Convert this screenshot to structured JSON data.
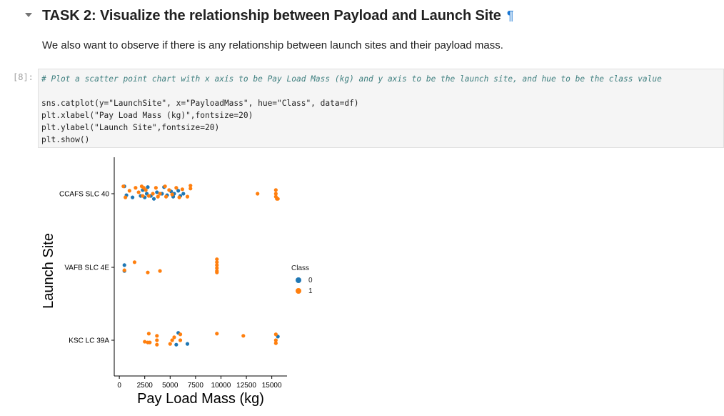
{
  "markdown": {
    "heading": "TASK 2: Visualize the relationship between Payload and Launch Site",
    "anchor": "¶",
    "intro": "We also want to observe if there is any relationship between launch sites and their payload mass."
  },
  "code_cell": {
    "prompt": "[8]:",
    "lines": [
      "# Plot a scatter point chart with x axis to be Pay Load Mass (kg) and y axis to be the launch site, and hue to be the class value",
      "",
      "sns.catplot(y=\"LaunchSite\", x=\"PayloadMass\", hue=\"Class\", data=df)",
      "plt.xlabel(\"Pay Load Mass (kg)\",fontsize=20)",
      "plt.ylabel(\"Launch Site\",fontsize=20)",
      "plt.show()"
    ]
  },
  "chart_data": {
    "type": "scatter",
    "xlabel": "Pay Load Mass (kg)",
    "ylabel": "Launch Site",
    "categories": [
      "CCAFS SLC 40",
      "VAFB SLC 4E",
      "KSC LC 39A"
    ],
    "x_ticks": [
      "0",
      "2500",
      "5000",
      "7500",
      "10000",
      "12500",
      "15000"
    ],
    "xlim": [
      -500,
      16500
    ],
    "legend": {
      "title": "Class",
      "placement": "right",
      "entries": [
        "0",
        "1"
      ]
    },
    "colors": {
      "0": "#1f77b4",
      "1": "#ff7f0e"
    },
    "series": [
      {
        "name": "0",
        "points": [
          {
            "site": "CCAFS SLC 40",
            "x": 500,
            "j": -0.1
          },
          {
            "site": "CCAFS SLC 40",
            "x": 700,
            "j": 0.02
          },
          {
            "site": "CCAFS SLC 40",
            "x": 1300,
            "j": 0.05
          },
          {
            "site": "CCAFS SLC 40",
            "x": 2100,
            "j": 0.03
          },
          {
            "site": "CCAFS SLC 40",
            "x": 2300,
            "j": -0.05
          },
          {
            "site": "CCAFS SLC 40",
            "x": 2500,
            "j": 0.05
          },
          {
            "site": "CCAFS SLC 40",
            "x": 2700,
            "j": 0.0
          },
          {
            "site": "CCAFS SLC 40",
            "x": 2800,
            "j": -0.09
          },
          {
            "site": "CCAFS SLC 40",
            "x": 3100,
            "j": 0.03
          },
          {
            "site": "CCAFS SLC 40",
            "x": 3400,
            "j": 0.07
          },
          {
            "site": "CCAFS SLC 40",
            "x": 3700,
            "j": -0.02
          },
          {
            "site": "CCAFS SLC 40",
            "x": 4200,
            "j": 0.0
          },
          {
            "site": "CCAFS SLC 40",
            "x": 4400,
            "j": -0.09
          },
          {
            "site": "CCAFS SLC 40",
            "x": 4700,
            "j": 0.02
          },
          {
            "site": "CCAFS SLC 40",
            "x": 5100,
            "j": -0.03
          },
          {
            "site": "CCAFS SLC 40",
            "x": 5300,
            "j": 0.04
          },
          {
            "site": "CCAFS SLC 40",
            "x": 5400,
            "j": 0.0
          },
          {
            "site": "CCAFS SLC 40",
            "x": 5800,
            "j": -0.04
          },
          {
            "site": "CCAFS SLC 40",
            "x": 6000,
            "j": 0.03
          },
          {
            "site": "CCAFS SLC 40",
            "x": 6300,
            "j": 0.0
          },
          {
            "site": "VAFB SLC 4E",
            "x": 500,
            "j": -0.03
          },
          {
            "site": "VAFB SLC 4E",
            "x": 500,
            "j": 0.05
          },
          {
            "site": "KSC LC 39A",
            "x": 5800,
            "j": -0.1
          },
          {
            "site": "KSC LC 39A",
            "x": 5600,
            "j": 0.06
          },
          {
            "site": "KSC LC 39A",
            "x": 6700,
            "j": 0.05
          },
          {
            "site": "KSC LC 39A",
            "x": 15600,
            "j": -0.05
          }
        ]
      },
      {
        "name": "1",
        "points": [
          {
            "site": "CCAFS SLC 40",
            "x": 400,
            "j": -0.1
          },
          {
            "site": "CCAFS SLC 40",
            "x": 600,
            "j": 0.05
          },
          {
            "site": "CCAFS SLC 40",
            "x": 1000,
            "j": -0.04
          },
          {
            "site": "CCAFS SLC 40",
            "x": 1600,
            "j": -0.08
          },
          {
            "site": "CCAFS SLC 40",
            "x": 1900,
            "j": -0.02
          },
          {
            "site": "CCAFS SLC 40",
            "x": 2200,
            "j": -0.1
          },
          {
            "site": "CCAFS SLC 40",
            "x": 2300,
            "j": 0.03
          },
          {
            "site": "CCAFS SLC 40",
            "x": 2400,
            "j": -0.08
          },
          {
            "site": "CCAFS SLC 40",
            "x": 2600,
            "j": -0.05
          },
          {
            "site": "CCAFS SLC 40",
            "x": 2900,
            "j": 0.03
          },
          {
            "site": "CCAFS SLC 40",
            "x": 3300,
            "j": 0.0
          },
          {
            "site": "CCAFS SLC 40",
            "x": 3600,
            "j": -0.08
          },
          {
            "site": "CCAFS SLC 40",
            "x": 3800,
            "j": 0.04
          },
          {
            "site": "CCAFS SLC 40",
            "x": 4000,
            "j": 0.0
          },
          {
            "site": "CCAFS SLC 40",
            "x": 4500,
            "j": -0.1
          },
          {
            "site": "CCAFS SLC 40",
            "x": 4600,
            "j": 0.04
          },
          {
            "site": "CCAFS SLC 40",
            "x": 4900,
            "j": -0.05
          },
          {
            "site": "CCAFS SLC 40",
            "x": 5200,
            "j": 0.01
          },
          {
            "site": "CCAFS SLC 40",
            "x": 5600,
            "j": -0.08
          },
          {
            "site": "CCAFS SLC 40",
            "x": 5900,
            "j": 0.05
          },
          {
            "site": "CCAFS SLC 40",
            "x": 6200,
            "j": -0.06
          },
          {
            "site": "CCAFS SLC 40",
            "x": 6700,
            "j": 0.04
          },
          {
            "site": "CCAFS SLC 40",
            "x": 7000,
            "j": -0.07
          },
          {
            "site": "CCAFS SLC 40",
            "x": 7000,
            "j": -0.11
          },
          {
            "site": "CCAFS SLC 40",
            "x": 13600,
            "j": 0.0
          },
          {
            "site": "CCAFS SLC 40",
            "x": 15400,
            "j": -0.05
          },
          {
            "site": "CCAFS SLC 40",
            "x": 15400,
            "j": 0.0
          },
          {
            "site": "CCAFS SLC 40",
            "x": 15400,
            "j": 0.04
          },
          {
            "site": "CCAFS SLC 40",
            "x": 15500,
            "j": 0.07
          },
          {
            "site": "CCAFS SLC 40",
            "x": 15600,
            "j": 0.07
          },
          {
            "site": "VAFB SLC 4E",
            "x": 500,
            "j": 0.04
          },
          {
            "site": "VAFB SLC 4E",
            "x": 1500,
            "j": -0.07
          },
          {
            "site": "VAFB SLC 4E",
            "x": 2800,
            "j": 0.07
          },
          {
            "site": "VAFB SLC 4E",
            "x": 4000,
            "j": 0.05
          },
          {
            "site": "VAFB SLC 4E",
            "x": 9600,
            "j": -0.11
          },
          {
            "site": "VAFB SLC 4E",
            "x": 9600,
            "j": -0.07
          },
          {
            "site": "VAFB SLC 4E",
            "x": 9600,
            "j": -0.03
          },
          {
            "site": "VAFB SLC 4E",
            "x": 9600,
            "j": 0.01
          },
          {
            "site": "VAFB SLC 4E",
            "x": 9600,
            "j": 0.05
          },
          {
            "site": "VAFB SLC 4E",
            "x": 9600,
            "j": 0.07
          },
          {
            "site": "KSC LC 39A",
            "x": 2500,
            "j": 0.02
          },
          {
            "site": "KSC LC 39A",
            "x": 2800,
            "j": 0.03
          },
          {
            "site": "KSC LC 39A",
            "x": 3000,
            "j": 0.03
          },
          {
            "site": "KSC LC 39A",
            "x": 2900,
            "j": -0.09
          },
          {
            "site": "KSC LC 39A",
            "x": 3700,
            "j": -0.06
          },
          {
            "site": "KSC LC 39A",
            "x": 3700,
            "j": 0.0
          },
          {
            "site": "KSC LC 39A",
            "x": 3700,
            "j": 0.06
          },
          {
            "site": "KSC LC 39A",
            "x": 5000,
            "j": 0.05
          },
          {
            "site": "KSC LC 39A",
            "x": 5200,
            "j": 0.0
          },
          {
            "site": "KSC LC 39A",
            "x": 5400,
            "j": -0.04
          },
          {
            "site": "KSC LC 39A",
            "x": 6000,
            "j": -0.08
          },
          {
            "site": "KSC LC 39A",
            "x": 6000,
            "j": 0.0
          },
          {
            "site": "KSC LC 39A",
            "x": 9600,
            "j": -0.09
          },
          {
            "site": "KSC LC 39A",
            "x": 12200,
            "j": -0.06
          },
          {
            "site": "KSC LC 39A",
            "x": 15400,
            "j": -0.08
          },
          {
            "site": "KSC LC 39A",
            "x": 15400,
            "j": 0.0
          },
          {
            "site": "KSC LC 39A",
            "x": 15400,
            "j": 0.04
          }
        ]
      }
    ]
  }
}
